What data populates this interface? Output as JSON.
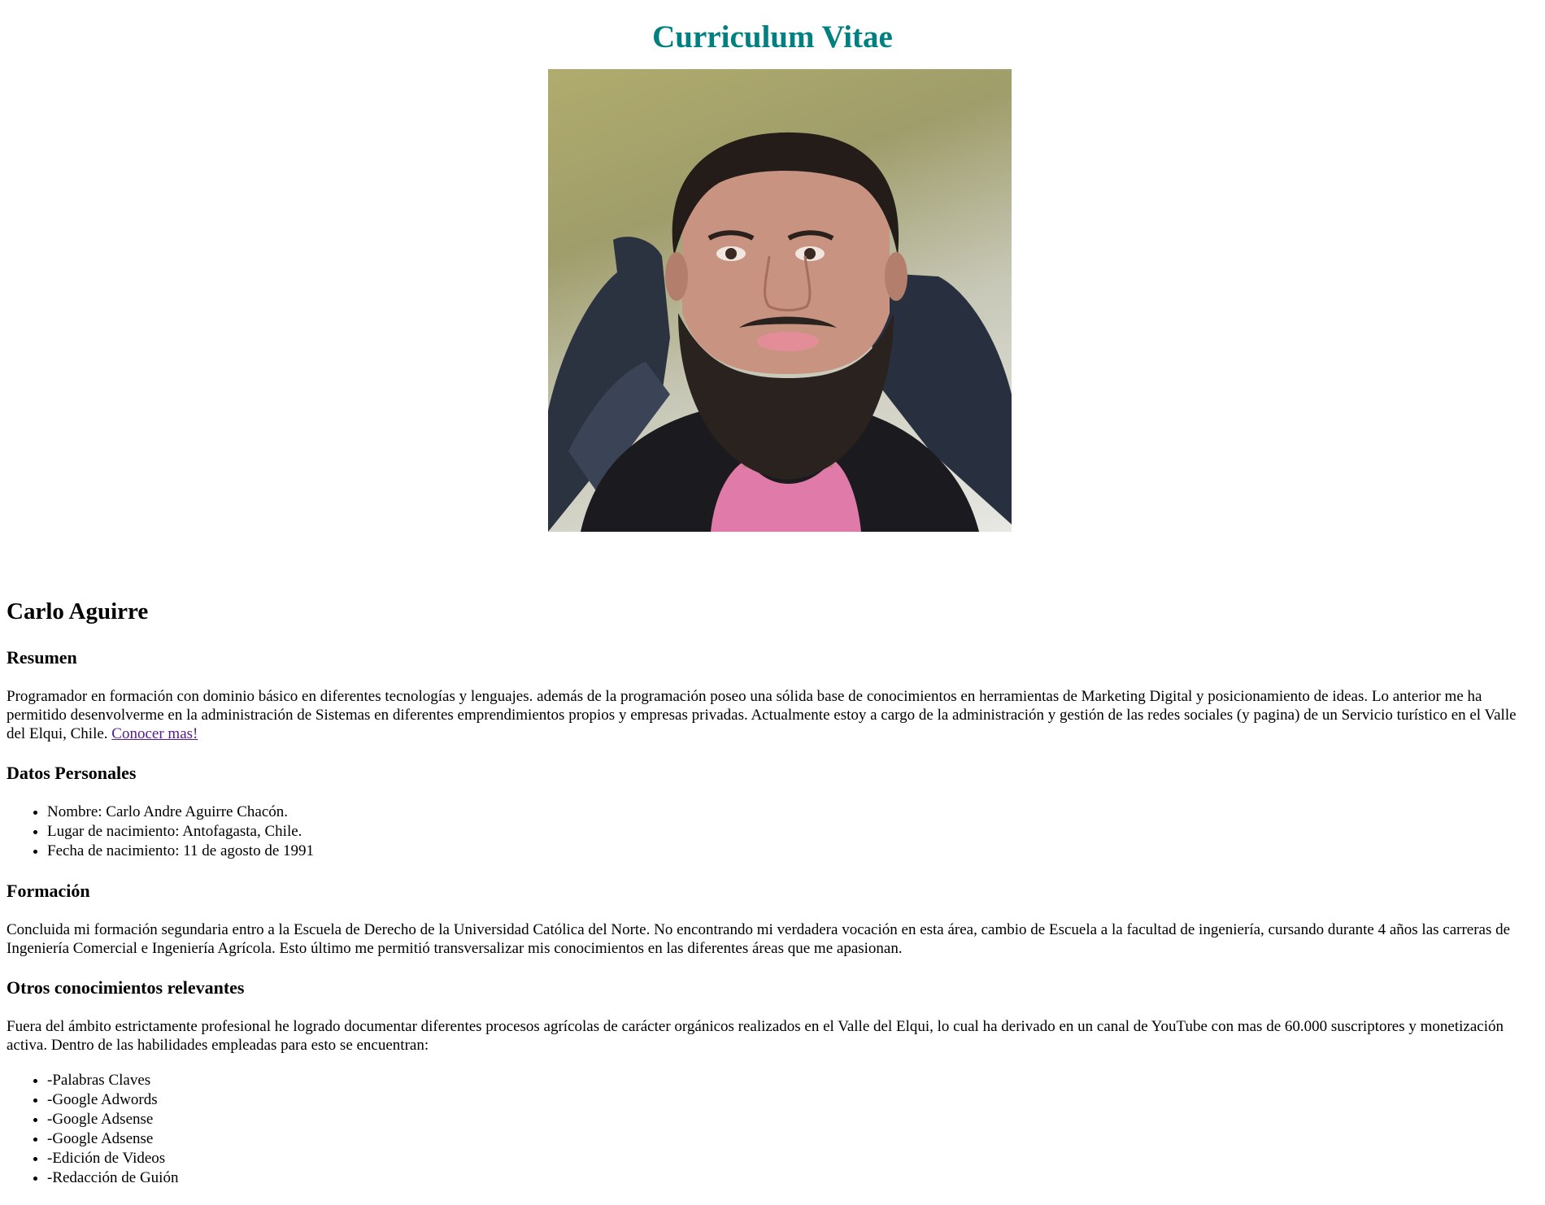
{
  "header": {
    "title": "Curriculum Vitae"
  },
  "profile": {
    "name": "Carlo Aguirre"
  },
  "resumen": {
    "heading": "Resumen",
    "text": "Programador en formación con dominio básico en diferentes tecnologías y lenguajes. además de la programación poseo una sólida base de conocimientos en herramientas de Marketing Digital y posicionamiento de ideas. Lo anterior me ha permitido desenvolverme en la administración de Sistemas en diferentes emprendimientos propios y empresas privadas. Actualmente estoy a cargo de la administración y gestión de las redes sociales (y pagina) de un Servicio turístico en el Valle del Elqui, Chile.",
    "link_label": "Conocer mas!"
  },
  "datos": {
    "heading": "Datos Personales",
    "items": [
      "Nombre: Carlo Andre Aguirre Chacón.",
      "Lugar de nacimiento: Antofagasta, Chile.",
      "Fecha de nacimiento: 11 de agosto de 1991"
    ]
  },
  "formacion": {
    "heading": "Formación",
    "text": "Concluida mi formación segundaria entro a la Escuela de Derecho de la Universidad Católica del Norte. No encontrando mi verdadera vocación en esta área, cambio de Escuela a la facultad de ingeniería, cursando durante 4 años las carreras de Ingeniería Comercial e Ingeniería Agrícola. Esto último me permitió transversalizar mis conocimientos en las diferentes áreas que me apasionan."
  },
  "otros": {
    "heading": "Otros conocimientos relevantes",
    "text": "Fuera del ámbito estrictamente profesional he logrado documentar diferentes procesos agrícolas de carácter orgánicos realizados en el Valle del Elqui, lo cual ha derivado en un canal de YouTube con mas de 60.000 suscriptores y monetización activa. Dentro de las habilidades empleadas para esto se encuentran:",
    "skills": [
      "-Palabras Claves",
      "-Google Adwords",
      "-Google Adsense",
      "-Google Adsense",
      "-Edición de Videos",
      "-Redacción de Guión"
    ]
  },
  "colors": {
    "title": "#008080",
    "visited_link": "#551a8b"
  }
}
